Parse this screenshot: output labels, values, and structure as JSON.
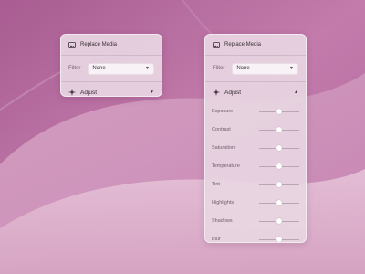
{
  "colors": {
    "background": "#b56a9d",
    "panel": "#e8d6e2",
    "text": "#3a3037",
    "muted": "#6f6069"
  },
  "panel_collapsed": {
    "replace_media": {
      "icon": "image-icon",
      "label": "Replace Media"
    },
    "filter": {
      "label": "Filter",
      "value": "None",
      "icon": "chevron-down-icon"
    },
    "adjust": {
      "icon": "sparkle-icon",
      "label": "Adjust",
      "caret_icon": "triangle-down-icon"
    }
  },
  "panel_expanded": {
    "replace_media": {
      "icon": "image-icon",
      "label": "Replace Media"
    },
    "filter": {
      "label": "Filter",
      "value": "None",
      "icon": "chevron-down-icon"
    },
    "adjust": {
      "icon": "sparkle-icon",
      "label": "Adjust",
      "caret_icon": "triangle-up-icon"
    },
    "sliders": [
      {
        "label": "Exposure",
        "value": 0.5
      },
      {
        "label": "Contrast",
        "value": 0.5
      },
      {
        "label": "Saturation",
        "value": 0.5
      },
      {
        "label": "Temperature",
        "value": 0.5
      },
      {
        "label": "Tint",
        "value": 0.5
      },
      {
        "label": "Highlights",
        "value": 0.5
      },
      {
        "label": "Shadows",
        "value": 0.5
      },
      {
        "label": "Blur",
        "value": 0.5
      }
    ]
  }
}
